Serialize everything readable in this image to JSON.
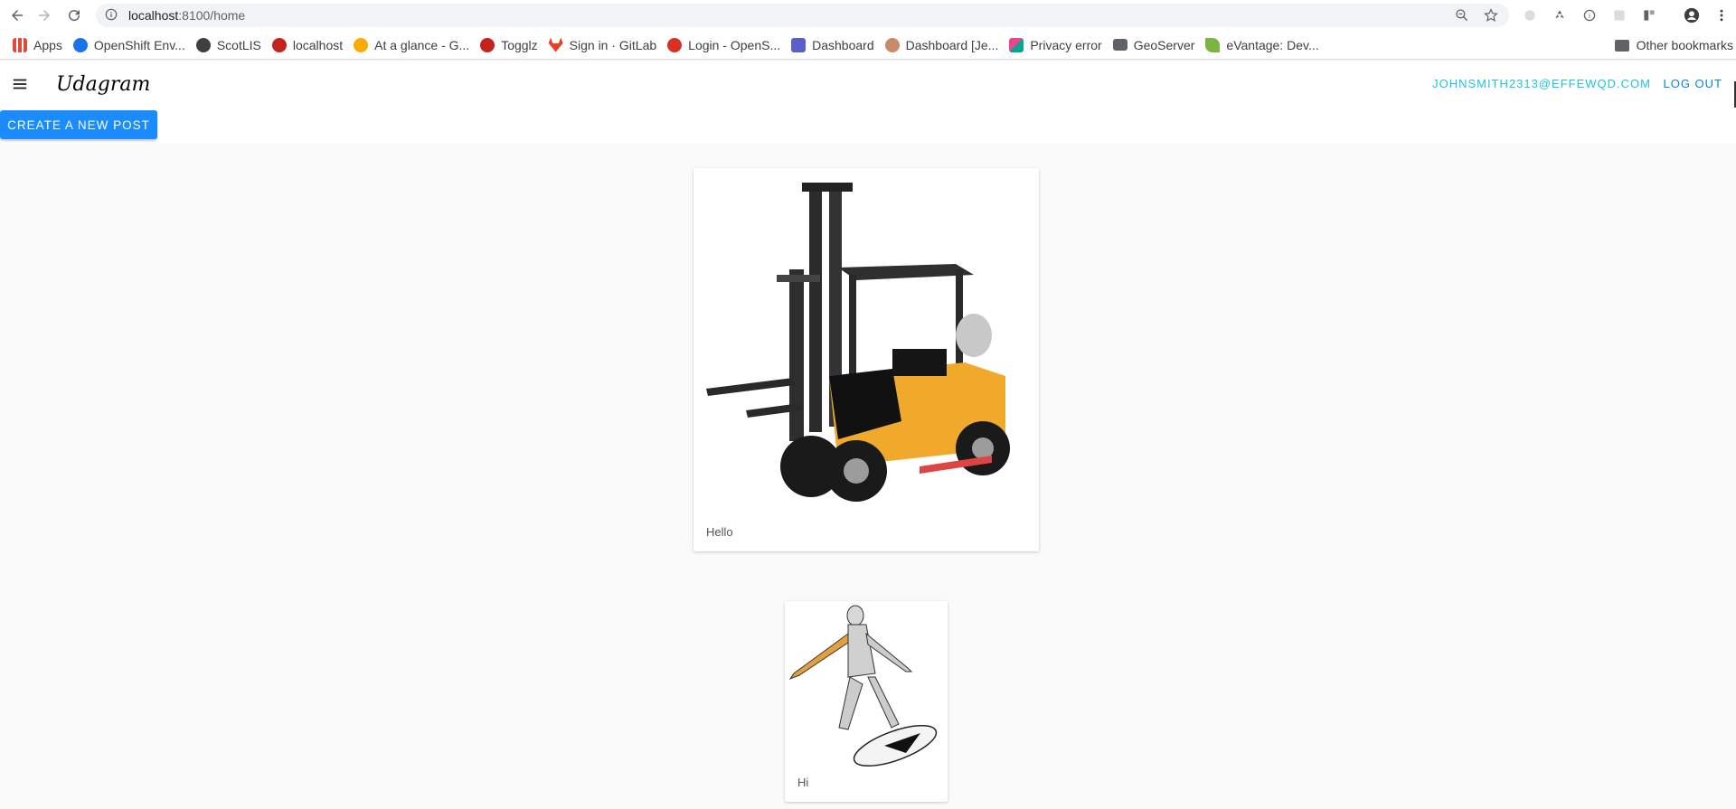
{
  "browser": {
    "url_host": "localhost",
    "url_path": ":8100/home",
    "bookmarks": [
      {
        "label": "Apps",
        "color": "#e04a3c"
      },
      {
        "label": "OpenShift Env...",
        "color": "#1a73e8"
      },
      {
        "label": "ScotLIS",
        "color": "#3c4043"
      },
      {
        "label": "localhost",
        "color": "#c5221f"
      },
      {
        "label": "At a glance - G...",
        "color": "#f9ab00"
      },
      {
        "label": "Togglz",
        "color": "#c5221f"
      },
      {
        "label": "Sign in · GitLab",
        "color": "#e24329"
      },
      {
        "label": "Login - OpenS...",
        "color": "#d93025"
      },
      {
        "label": "Dashboard",
        "color": "#5b5fc7"
      },
      {
        "label": "Dashboard [Je...",
        "color": "#c98b6b"
      },
      {
        "label": "Privacy error",
        "color": "#00a98f"
      },
      {
        "label": "GeoServer",
        "color": "#5f6368"
      },
      {
        "label": "eVantage: Dev...",
        "color": "#7cb342"
      }
    ],
    "other_bookmarks": "Other bookmarks"
  },
  "app": {
    "title": "Udagram",
    "user_email": "JOHNSMITH2313@EFFEWQD.COM",
    "logout_label": "LOG OUT",
    "new_post_label": "CREATE A NEW POST",
    "accent": "#1a8cff"
  },
  "feed": {
    "posts": [
      {
        "caption": "Hello",
        "image": "yellow toy forklift"
      },
      {
        "caption": "Hi",
        "image": "silver surfer comic figure"
      }
    ]
  }
}
